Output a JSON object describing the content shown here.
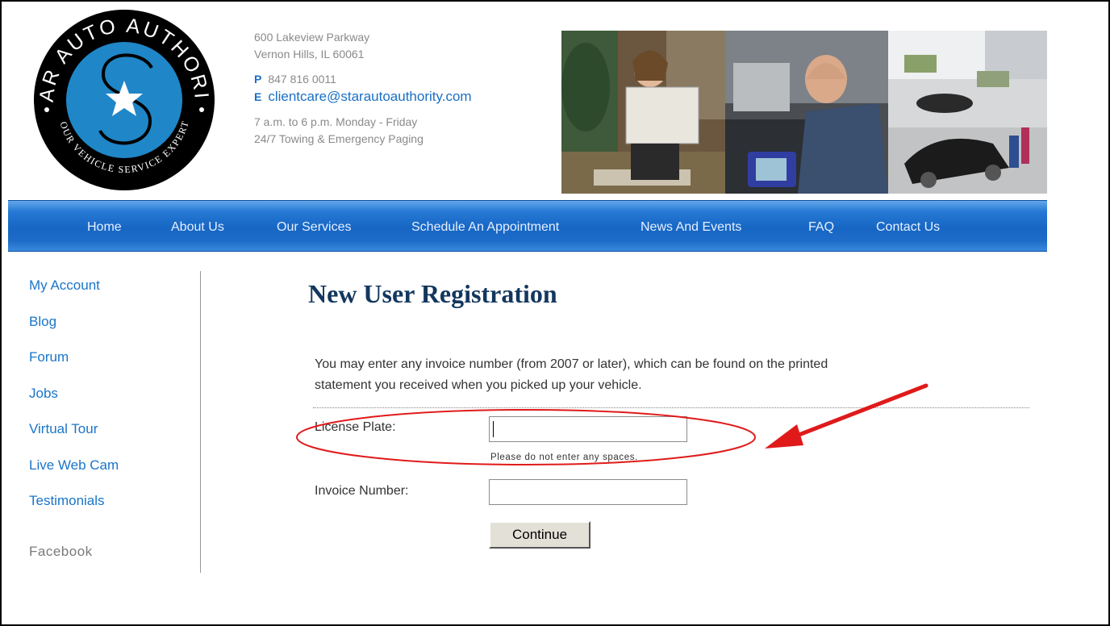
{
  "logo": {
    "top_text": "STAR AUTO AUTHORITY",
    "bottom_text": "YOUR VEHICLE SERVICE EXPERTS",
    "colors": {
      "ring": "#000000",
      "disc": "#1f86c8",
      "star": "#ffffff"
    }
  },
  "contact": {
    "address_line1": "600 Lakeview Parkway",
    "address_line2": "Vernon Hills, IL 60061",
    "phone_letter": "P",
    "phone": "847 816 0011",
    "email_letter": "E",
    "email": "clientcare@starautoauthority.com",
    "hours": "7 a.m. to 6 p.m. Monday - Friday",
    "towing": "24/7 Towing & Emergency Paging"
  },
  "nav": {
    "items": [
      "Home",
      "About Us",
      "Our Services",
      "Schedule An Appointment",
      "News And Events",
      "FAQ",
      "Contact Us"
    ],
    "color": "#1f6fcb"
  },
  "sidebar": {
    "items": [
      "My Account",
      "Blog",
      "Forum",
      "Jobs",
      "Virtual Tour",
      "Live Web Cam",
      "Testimonials"
    ],
    "facebook": "Facebook"
  },
  "main": {
    "title": "New User Registration",
    "intro_line1": "You may enter any invoice number (from 2007 or later), which can be found on the printed",
    "intro_line2": "statement you received when you picked up your vehicle.",
    "license_label": "License Plate:",
    "license_value": "",
    "license_hint": "Please do not enter any spaces.",
    "invoice_label": "Invoice Number:",
    "invoice_value": "",
    "continue_label": "Continue"
  },
  "annotation": {
    "color": "#e01a1a"
  }
}
